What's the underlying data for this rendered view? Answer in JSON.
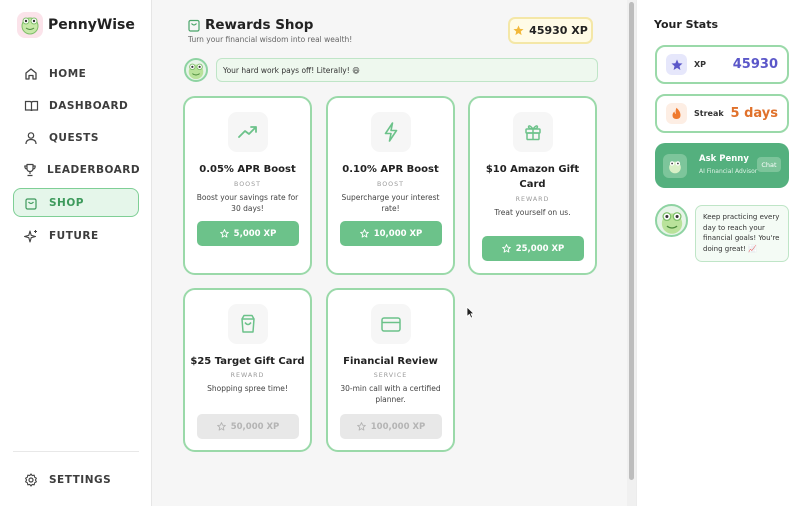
{
  "app": {
    "name": "PennyWise"
  },
  "sidebar": {
    "items": [
      {
        "label": "HOME",
        "icon": "home-icon"
      },
      {
        "label": "DASHBOARD",
        "icon": "book-icon"
      },
      {
        "label": "QUESTS",
        "icon": "user-icon"
      },
      {
        "label": "LEADERBOARD",
        "icon": "trophy-icon"
      },
      {
        "label": "SHOP",
        "icon": "shopping-bag-icon",
        "active": true
      },
      {
        "label": "FUTURE",
        "icon": "sparkles-icon"
      }
    ],
    "settings": {
      "label": "SETTINGS",
      "icon": "gear-icon"
    }
  },
  "header": {
    "title": "Rewards Shop",
    "subtitle": "Turn your financial wisdom into real wealth!",
    "xp_balance": "45930 XP"
  },
  "banner": {
    "message": "Your hard work pays off! Literally! 😄"
  },
  "shop": {
    "items": [
      {
        "name": "0.05% APR Boost",
        "category": "BOOST",
        "description": "Boost your savings rate for 30 days!",
        "price": "5,000 XP",
        "icon": "trending-up-icon",
        "affordable": true
      },
      {
        "name": "0.10% APR Boost",
        "category": "BOOST",
        "description": "Supercharge your interest rate!",
        "price": "10,000 XP",
        "icon": "lightning-icon",
        "affordable": true
      },
      {
        "name": "$10 Amazon Gift Card",
        "category": "REWARD",
        "description": "Treat yourself on us.",
        "price": "25,000 XP",
        "icon": "gift-icon",
        "affordable": true
      },
      {
        "name": "$25 Target Gift Card",
        "category": "REWARD",
        "description": "Shopping spree time!",
        "price": "50,000 XP",
        "icon": "shopping-bag-icon",
        "affordable": false
      },
      {
        "name": "Financial Review",
        "category": "SERVICE",
        "description": "30-min call with a certified planner.",
        "price": "100,000 XP",
        "icon": "credit-card-icon",
        "affordable": false
      }
    ]
  },
  "stats": {
    "heading": "Your Stats",
    "xp": {
      "label": "XP",
      "value": "45930"
    },
    "streak": {
      "label": "Streak",
      "value": "5 days"
    }
  },
  "penny": {
    "title": "Ask Penny",
    "subtitle": "AI Financial Advisor",
    "chat_label": "Chat"
  },
  "tip": {
    "message": "Keep practicing every day to reach your financial goals! You're doing great! 📈"
  },
  "colors": {
    "accent": "#6cc28a",
    "accent_border": "#9ad9a9",
    "xp_value": "#5b57c9",
    "streak_value": "#e0712b",
    "penny_bg": "#54b07e"
  }
}
